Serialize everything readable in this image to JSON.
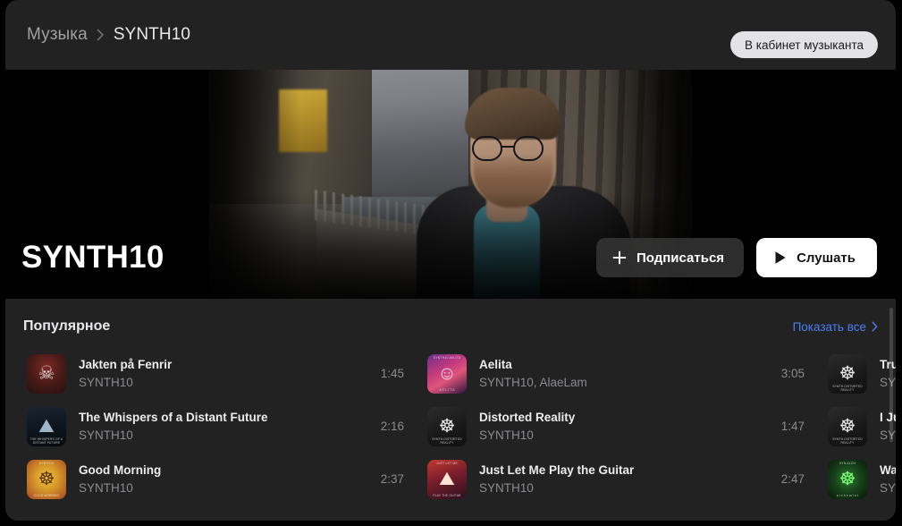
{
  "breadcrumb": {
    "root": "Музыка",
    "separator_icon": "chevron-right-icon",
    "current": "SYNTH10"
  },
  "topbar": {
    "cabinet_button": "В кабинет музыканта"
  },
  "hero": {
    "artist_name": "SYNTH10",
    "subscribe_label": "Подписаться",
    "subscribe_icon": "plus-icon",
    "listen_label": "Слушать",
    "listen_icon": "play-icon"
  },
  "popular": {
    "title": "Популярное",
    "show_all_label": "Показать все",
    "show_all_icon": "chevron-right-icon",
    "columns": [
      {
        "tracks": [
          {
            "title": "Jakten på Fenrir",
            "artist": "SYNTH10",
            "duration": "1:45",
            "cover_class": "cv-fenrir",
            "cover_glyph": "☠",
            "cover_topline": "",
            "cover_capline": ""
          },
          {
            "title": "The Whispers of a Distant Future",
            "artist": "SYNTH10",
            "duration": "2:16",
            "cover_class": "cv-whispers",
            "cover_glyph": "⛰",
            "cover_topline": "",
            "cover_capline": "THE WHISPERS OF A DISTANT FUTURE"
          },
          {
            "title": "Good Morning",
            "artist": "SYNTH10",
            "duration": "2:37",
            "cover_class": "cv-goodmorning",
            "cover_glyph": "☸",
            "cover_topline": "SYNTH10",
            "cover_capline": "GOOD MORNING"
          }
        ]
      },
      {
        "tracks": [
          {
            "title": "Aelita",
            "artist": "SYNTH10, AlaeLam",
            "duration": "3:05",
            "cover_class": "cv-aelita",
            "cover_glyph": "☺",
            "cover_topline": "SYNTH10   AELITA",
            "cover_capline": "A E L I T A"
          },
          {
            "title": "Distorted Reality",
            "artist": "SYNTH10",
            "duration": "1:47",
            "cover_class": "cv-distorted",
            "cover_glyph": "☸",
            "cover_topline": "",
            "cover_capline": "SYNTH DISTORTED REALITY"
          },
          {
            "title": "Just Let Me Play the Guitar",
            "artist": "SYNTH10",
            "duration": "2:47",
            "cover_class": "cv-guitar",
            "cover_glyph": "⛰",
            "cover_topline": "JUST LET ME",
            "cover_capline": "PLAY THE GUITAR"
          }
        ]
      },
      {
        "tracks": [
          {
            "title": "Tru",
            "artist": "SY",
            "duration": "",
            "cover_class": "cv-distorted",
            "cover_glyph": "☸",
            "cover_topline": "",
            "cover_capline": "SYNTH DISTORTED REALITY"
          },
          {
            "title": "I Ju",
            "artist": "SY",
            "duration": "",
            "cover_class": "cv-distorted",
            "cover_glyph": "☸",
            "cover_topline": "",
            "cover_capline": "SYNTH DISTORTED REALITY"
          },
          {
            "title": "Wa",
            "artist": "SY",
            "duration": "",
            "cover_class": "cv-green",
            "cover_glyph": "☸",
            "cover_topline": "SYN        ALCH",
            "cover_capline": "a l c h e m i s t"
          }
        ]
      }
    ]
  },
  "colors": {
    "page_background": "#000000",
    "card_background": "#222222",
    "accent_link": "#4b7ef0",
    "primary_text": "#ececee",
    "secondary_text": "#8b8b90",
    "button_light": "#e3e3e6"
  }
}
